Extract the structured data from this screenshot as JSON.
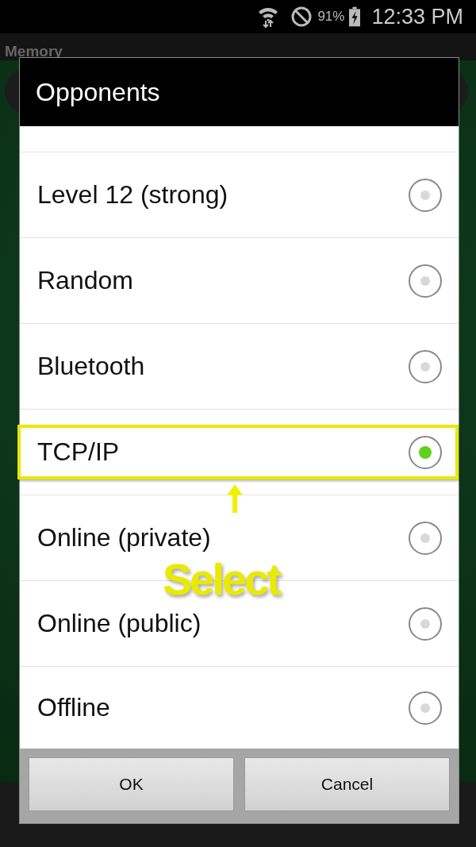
{
  "status_bar": {
    "battery": "91%",
    "time": "12:33 PM"
  },
  "app_bar": {
    "title": "Memory"
  },
  "dialog": {
    "title": "Opponents",
    "options": [
      {
        "label": "Level 12 (strong)",
        "selected": false
      },
      {
        "label": "Random",
        "selected": false
      },
      {
        "label": "Bluetooth",
        "selected": false
      },
      {
        "label": "TCP/IP",
        "selected": true
      },
      {
        "label": "Online (private)",
        "selected": false
      },
      {
        "label": "Online (public)",
        "selected": false
      },
      {
        "label": "Offline",
        "selected": false
      }
    ],
    "buttons": [
      "OK",
      "Cancel"
    ]
  },
  "annotation": {
    "label": "Select"
  }
}
